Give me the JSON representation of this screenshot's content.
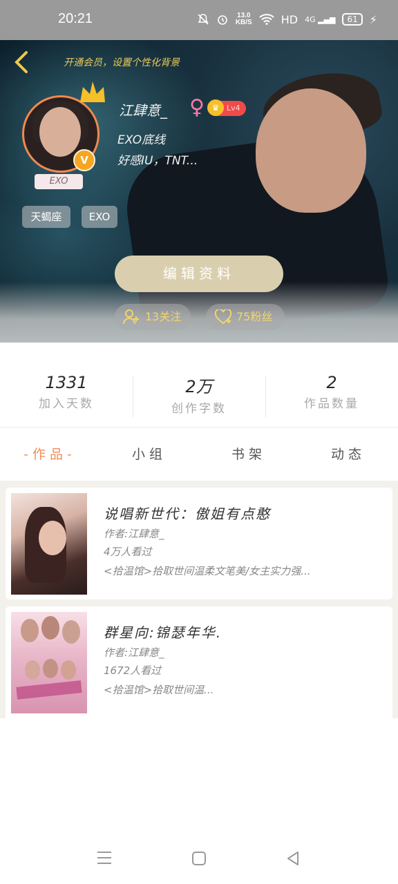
{
  "status": {
    "time": "20:21",
    "speed_top": "13.0",
    "speed_unit": "KB/S",
    "hd": "HD",
    "net": "4G",
    "battery": "61"
  },
  "profile": {
    "vip_link": "开通会员，设置个性化背景",
    "username": "江肆意_",
    "gender_symbol": "♀",
    "level": "Lv4",
    "bio_line1": "EXO底线",
    "bio_line2": "好感IU，TNT...",
    "small_tag": "EXO",
    "tags": [
      "天蝎座",
      "EXO"
    ],
    "edit_button": "编辑资料",
    "following": "13关注",
    "followers": "75粉丝"
  },
  "stats": [
    {
      "value": "1331",
      "label": "加入天数"
    },
    {
      "value": "2万",
      "label": "创作字数"
    },
    {
      "value": "2",
      "label": "作品数量"
    }
  ],
  "tabs": [
    "-作品-",
    "小组",
    "书架",
    "动态"
  ],
  "works": [
    {
      "title": "说唱新世代：傲姐有点憨",
      "author": "作者:江肆意_",
      "reads": "4万人看过",
      "desc": "<拾温馆>拾取世间温柔文笔美/女主实力强..."
    },
    {
      "title": "群星向:锦瑟年华.",
      "author": "作者:江肆意_",
      "reads": "1672人看过",
      "desc": "<拾温馆>拾取世间温..."
    }
  ],
  "icons": {
    "back": "chevron-left-icon",
    "crown": "crown-icon",
    "follow": "add-user-icon",
    "heart": "heart-icon"
  },
  "colors": {
    "accent": "#ef8f5a",
    "gold": "#e9c95a",
    "edit_button": "#d9cfae"
  }
}
